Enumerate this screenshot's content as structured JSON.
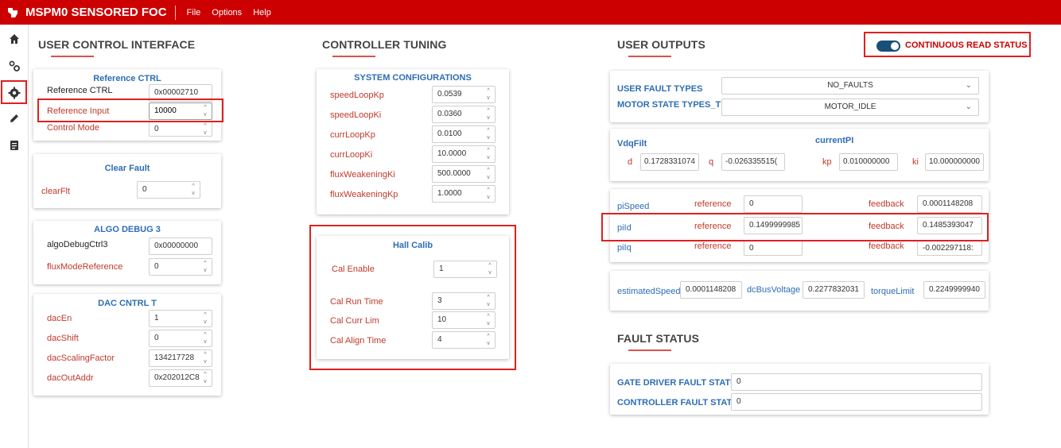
{
  "app": {
    "title": "MSPM0 SENSORED FOC",
    "menu": [
      "File",
      "Options",
      "Help"
    ]
  },
  "sidebar": {
    "icons": [
      "home-icon",
      "gears-icon",
      "settings-icon",
      "pencil-icon",
      "document-icon"
    ]
  },
  "sections": {
    "user_control": "USER CONTROL INTERFACE",
    "controller_tuning": "CONTROLLER TUNING",
    "user_outputs": "USER OUTPUTS",
    "fault_status": "FAULT STATUS"
  },
  "continuous_read": {
    "label": "CONTINUOUS READ STATUS",
    "on": true
  },
  "reference_ctrl": {
    "title": "Reference CTRL",
    "rows": [
      {
        "label": "Reference CTRL",
        "value": "0x00002710"
      },
      {
        "label": "Reference Input",
        "value": "10000"
      },
      {
        "label": "Control Mode",
        "value": "0"
      }
    ]
  },
  "clear_fault": {
    "title": "Clear Fault",
    "label": "clearFlt",
    "value": "0"
  },
  "algo_debug": {
    "title": "ALGO DEBUG 3",
    "rows": [
      {
        "label": "algoDebugCtrl3",
        "value": "0x00000000"
      },
      {
        "label": "fluxModeReference",
        "value": "0"
      }
    ]
  },
  "dac_ctrl": {
    "title": "DAC CNTRL T",
    "rows": [
      {
        "label": "dacEn",
        "value": "1"
      },
      {
        "label": "dacShift",
        "value": "0"
      },
      {
        "label": "dacScalingFactor",
        "value": "134217728"
      },
      {
        "label": "dacOutAddr",
        "value": "0x202012C8"
      }
    ]
  },
  "system_config": {
    "title": "SYSTEM CONFIGURATIONS",
    "rows": [
      {
        "label": "speedLoopKp",
        "value": "0.0539"
      },
      {
        "label": "speedLoopKi",
        "value": "0.0360"
      },
      {
        "label": "currLoopKp",
        "value": "0.0100"
      },
      {
        "label": "currLoopKi",
        "value": "10.0000"
      },
      {
        "label": "fluxWeakeningKi",
        "value": "500.0000"
      },
      {
        "label": "fluxWeakeningKp",
        "value": "1.0000"
      }
    ]
  },
  "hall_calib": {
    "title": "Hall Calib",
    "rows": [
      {
        "label": "Cal Enable",
        "value": "1"
      },
      {
        "label": "Cal Run Time",
        "value": "3"
      },
      {
        "label": "Cal Curr Lim",
        "value": "10"
      },
      {
        "label": "Cal Align Time",
        "value": "4"
      }
    ]
  },
  "types": {
    "fault_label": "USER FAULT TYPES",
    "fault_value": "NO_FAULTS",
    "motor_label": "MOTOR STATE TYPES_T",
    "motor_value": "MOTOR_IDLE"
  },
  "vdq": {
    "title": "VdqFilt",
    "current_title": "currentPI",
    "d_label": "d",
    "d_value": "0.1728331074",
    "q_label": "q",
    "q_value": "-0.026335515(",
    "kp_label": "kp",
    "kp_value": "0.010000000",
    "ki_label": "ki",
    "ki_value": "10.000000000"
  },
  "pi": {
    "rows": [
      {
        "name": "piSpeed",
        "ref_label": "reference",
        "ref": "0",
        "fb_label": "feedback",
        "fb": "0.0001148208"
      },
      {
        "name": "piId",
        "ref_label": "reference",
        "ref": "0.1499999985",
        "fb_label": "feedback",
        "fb": "0.1485393047"
      },
      {
        "name": "piIq",
        "ref_label": "reference",
        "ref": "0",
        "fb_label": "feedback",
        "fb": "-0.002297118:"
      }
    ]
  },
  "estimates": {
    "speed_label": "estimatedSpeed",
    "speed_value": "0.0001148208",
    "dcbus_label": "dcBusVoltage",
    "dcbus_value": "0.2277832031",
    "torque_label": "torqueLimit",
    "torque_value": "0.2249999940"
  },
  "fault": {
    "gate_label": "GATE DRIVER FAULT STATUS",
    "gate_value": "0",
    "ctrl_label": "CONTROLLER FAULT STATUS",
    "ctrl_value": "0"
  },
  "colors": {
    "brand": "#cc0000",
    "label_red": "#c0392b",
    "label_blue": "#2d6db5",
    "highlight": "#e02020"
  }
}
